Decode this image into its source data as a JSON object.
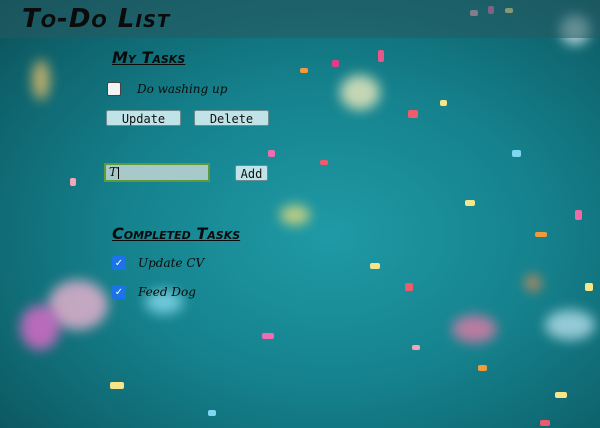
{
  "app": {
    "title": "To-Do List"
  },
  "my_tasks": {
    "heading": "My Tasks",
    "items": [
      {
        "label": "Do washing up",
        "checked": false
      }
    ],
    "update_label": "Update",
    "delete_label": "Delete"
  },
  "new_task": {
    "value": "T",
    "add_label": "Add"
  },
  "completed": {
    "heading": "Completed Tasks",
    "items": [
      {
        "label": "Update CV",
        "checked": true
      },
      {
        "label": "Feed Dog",
        "checked": true
      }
    ]
  },
  "colors": {
    "accent": "#1a73e8",
    "background": "#15828d",
    "button": "#bfe3e7"
  },
  "icons": {
    "checkmark": "check-icon"
  }
}
